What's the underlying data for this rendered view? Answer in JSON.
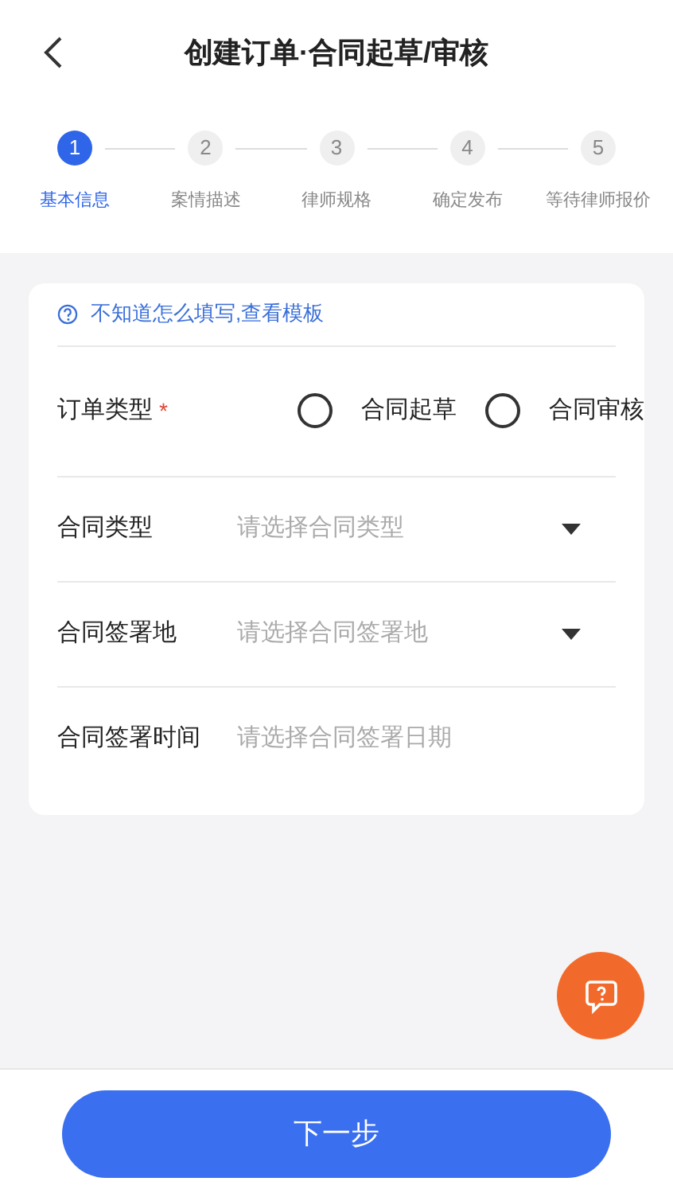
{
  "header": {
    "title": "创建订单·合同起草/审核"
  },
  "steps": [
    {
      "number": "1",
      "label": "基本信息",
      "selected": true
    },
    {
      "number": "2",
      "label": "案情描述",
      "selected": false
    },
    {
      "number": "3",
      "label": "律师规格",
      "selected": false
    },
    {
      "number": "4",
      "label": "确定发布",
      "selected": false
    },
    {
      "number": "5",
      "label": "等待律师报价",
      "selected": false
    }
  ],
  "help_link": "不知道怎么填写,查看模板",
  "form": [
    {
      "kind": "radio",
      "label": "订单类型",
      "required": "*",
      "options": [
        {
          "label": "合同起草",
          "selected": false
        },
        {
          "label": "合同审核",
          "selected": false
        }
      ]
    },
    {
      "kind": "select",
      "label": "合同类型",
      "placeholder": "请选择合同类型"
    },
    {
      "kind": "select",
      "label": "合同签署地",
      "placeholder": "请选择合同签署地"
    },
    {
      "kind": "date",
      "label": "合同签署时间",
      "placeholder": "请选择合同签署日期"
    }
  ],
  "next_button": "下一步"
}
